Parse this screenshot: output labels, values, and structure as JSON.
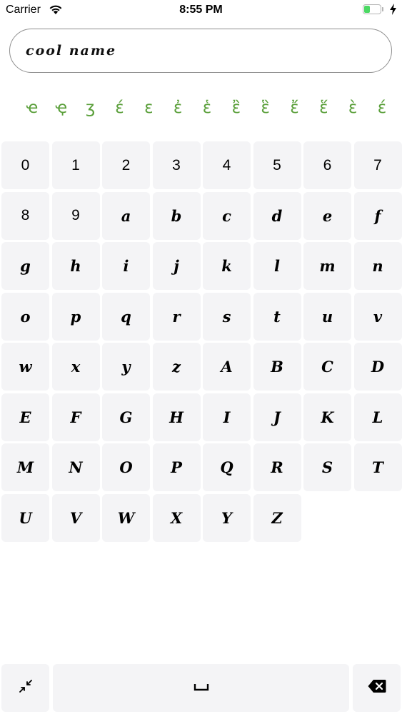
{
  "status_bar": {
    "carrier": "Carrier",
    "time": "8:55 PM",
    "battery_level": 0.35,
    "battery_color": "#4cd964",
    "icons": [
      "wifi-icon",
      "battery-icon",
      "charging-bolt-icon"
    ]
  },
  "input": {
    "value": "cool name"
  },
  "diacritics": [
    "ҽ",
    "ҿ",
    "ʒ",
    "έ",
    "ε",
    "ἐ",
    "ἑ",
    "ἒ",
    "ἓ",
    "ἔ",
    "ἕ",
    "ὲ",
    "έ"
  ],
  "accent_color": "#5a9f3a",
  "keys": [
    {
      "label": "0",
      "type": "digit"
    },
    {
      "label": "1",
      "type": "digit"
    },
    {
      "label": "2",
      "type": "digit"
    },
    {
      "label": "3",
      "type": "digit"
    },
    {
      "label": "4",
      "type": "digit"
    },
    {
      "label": "5",
      "type": "digit"
    },
    {
      "label": "6",
      "type": "digit"
    },
    {
      "label": "7",
      "type": "digit"
    },
    {
      "label": "8",
      "type": "digit"
    },
    {
      "label": "9",
      "type": "digit"
    },
    {
      "label": "a",
      "type": "script"
    },
    {
      "label": "b",
      "type": "script"
    },
    {
      "label": "c",
      "type": "script"
    },
    {
      "label": "d",
      "type": "script"
    },
    {
      "label": "e",
      "type": "script"
    },
    {
      "label": "f",
      "type": "script"
    },
    {
      "label": "g",
      "type": "script"
    },
    {
      "label": "h",
      "type": "script"
    },
    {
      "label": "i",
      "type": "script"
    },
    {
      "label": "j",
      "type": "script"
    },
    {
      "label": "k",
      "type": "script"
    },
    {
      "label": "l",
      "type": "script"
    },
    {
      "label": "m",
      "type": "script"
    },
    {
      "label": "n",
      "type": "script"
    },
    {
      "label": "o",
      "type": "script"
    },
    {
      "label": "p",
      "type": "script"
    },
    {
      "label": "q",
      "type": "script"
    },
    {
      "label": "r",
      "type": "script"
    },
    {
      "label": "s",
      "type": "script"
    },
    {
      "label": "t",
      "type": "script"
    },
    {
      "label": "u",
      "type": "script"
    },
    {
      "label": "v",
      "type": "script"
    },
    {
      "label": "w",
      "type": "script"
    },
    {
      "label": "x",
      "type": "script"
    },
    {
      "label": "y",
      "type": "script"
    },
    {
      "label": "z",
      "type": "script"
    },
    {
      "label": "A",
      "type": "script"
    },
    {
      "label": "B",
      "type": "script"
    },
    {
      "label": "C",
      "type": "script"
    },
    {
      "label": "D",
      "type": "script"
    },
    {
      "label": "E",
      "type": "script"
    },
    {
      "label": "F",
      "type": "script"
    },
    {
      "label": "G",
      "type": "script"
    },
    {
      "label": "H",
      "type": "script"
    },
    {
      "label": "I",
      "type": "script"
    },
    {
      "label": "J",
      "type": "script"
    },
    {
      "label": "K",
      "type": "script"
    },
    {
      "label": "L",
      "type": "script"
    },
    {
      "label": "M",
      "type": "script"
    },
    {
      "label": "N",
      "type": "script"
    },
    {
      "label": "O",
      "type": "script"
    },
    {
      "label": "P",
      "type": "script"
    },
    {
      "label": "Q",
      "type": "script"
    },
    {
      "label": "R",
      "type": "script"
    },
    {
      "label": "S",
      "type": "script"
    },
    {
      "label": "T",
      "type": "script"
    },
    {
      "label": "U",
      "type": "script"
    },
    {
      "label": "V",
      "type": "script"
    },
    {
      "label": "W",
      "type": "script"
    },
    {
      "label": "X",
      "type": "script"
    },
    {
      "label": "Y",
      "type": "script"
    },
    {
      "label": "Z",
      "type": "script"
    }
  ],
  "bottom_bar": {
    "collapse_icon": "collapse-arrows-icon",
    "space_icon": "space-bar-icon",
    "delete_icon": "backspace-icon"
  }
}
